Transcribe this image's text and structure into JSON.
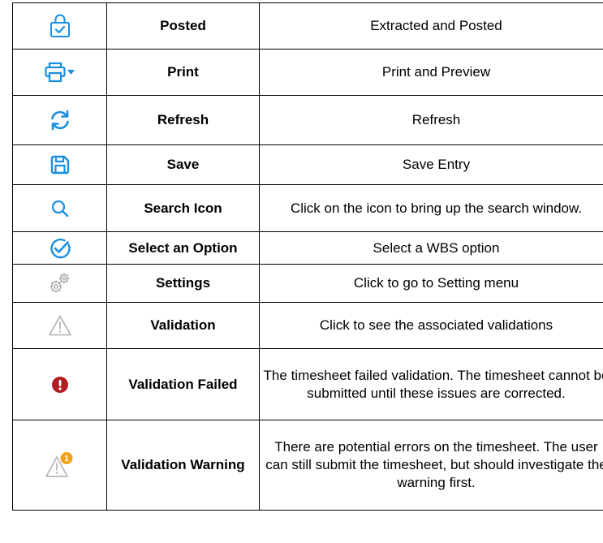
{
  "colors": {
    "icon_blue": "#1a8fe0",
    "icon_gray": "#b9b9b9",
    "error_red": "#b01e24",
    "badge_orange": "#f0a21a"
  },
  "rows": [
    {
      "icon": "posted-icon",
      "name": "Posted",
      "description": "Extracted and Posted"
    },
    {
      "icon": "print-icon",
      "name": "Print",
      "description": "Print and Preview"
    },
    {
      "icon": "refresh-icon",
      "name": "Refresh",
      "description": "Refresh"
    },
    {
      "icon": "save-icon",
      "name": "Save",
      "description": "Save Entry"
    },
    {
      "icon": "search-icon",
      "name": "Search Icon",
      "description": "Click on the icon to bring up the search window."
    },
    {
      "icon": "select-option-icon",
      "name": "Select an Option",
      "description": "Select a  WBS option"
    },
    {
      "icon": "settings-icon",
      "name": "Settings",
      "description": "Click to go to Setting menu"
    },
    {
      "icon": "validation-icon",
      "name": "Validation",
      "description": "Click to see the associated validations"
    },
    {
      "icon": "validation-failed-icon",
      "name": "Validation Failed",
      "description": "The timesheet failed validation. The timesheet cannot be submitted until these issues are corrected."
    },
    {
      "icon": "validation-warning-icon",
      "name": "Validation Warning",
      "badge": "1",
      "description": "There are potential errors on the timesheet. The user can still submit the timesheet, but should investigate the warning first."
    }
  ]
}
